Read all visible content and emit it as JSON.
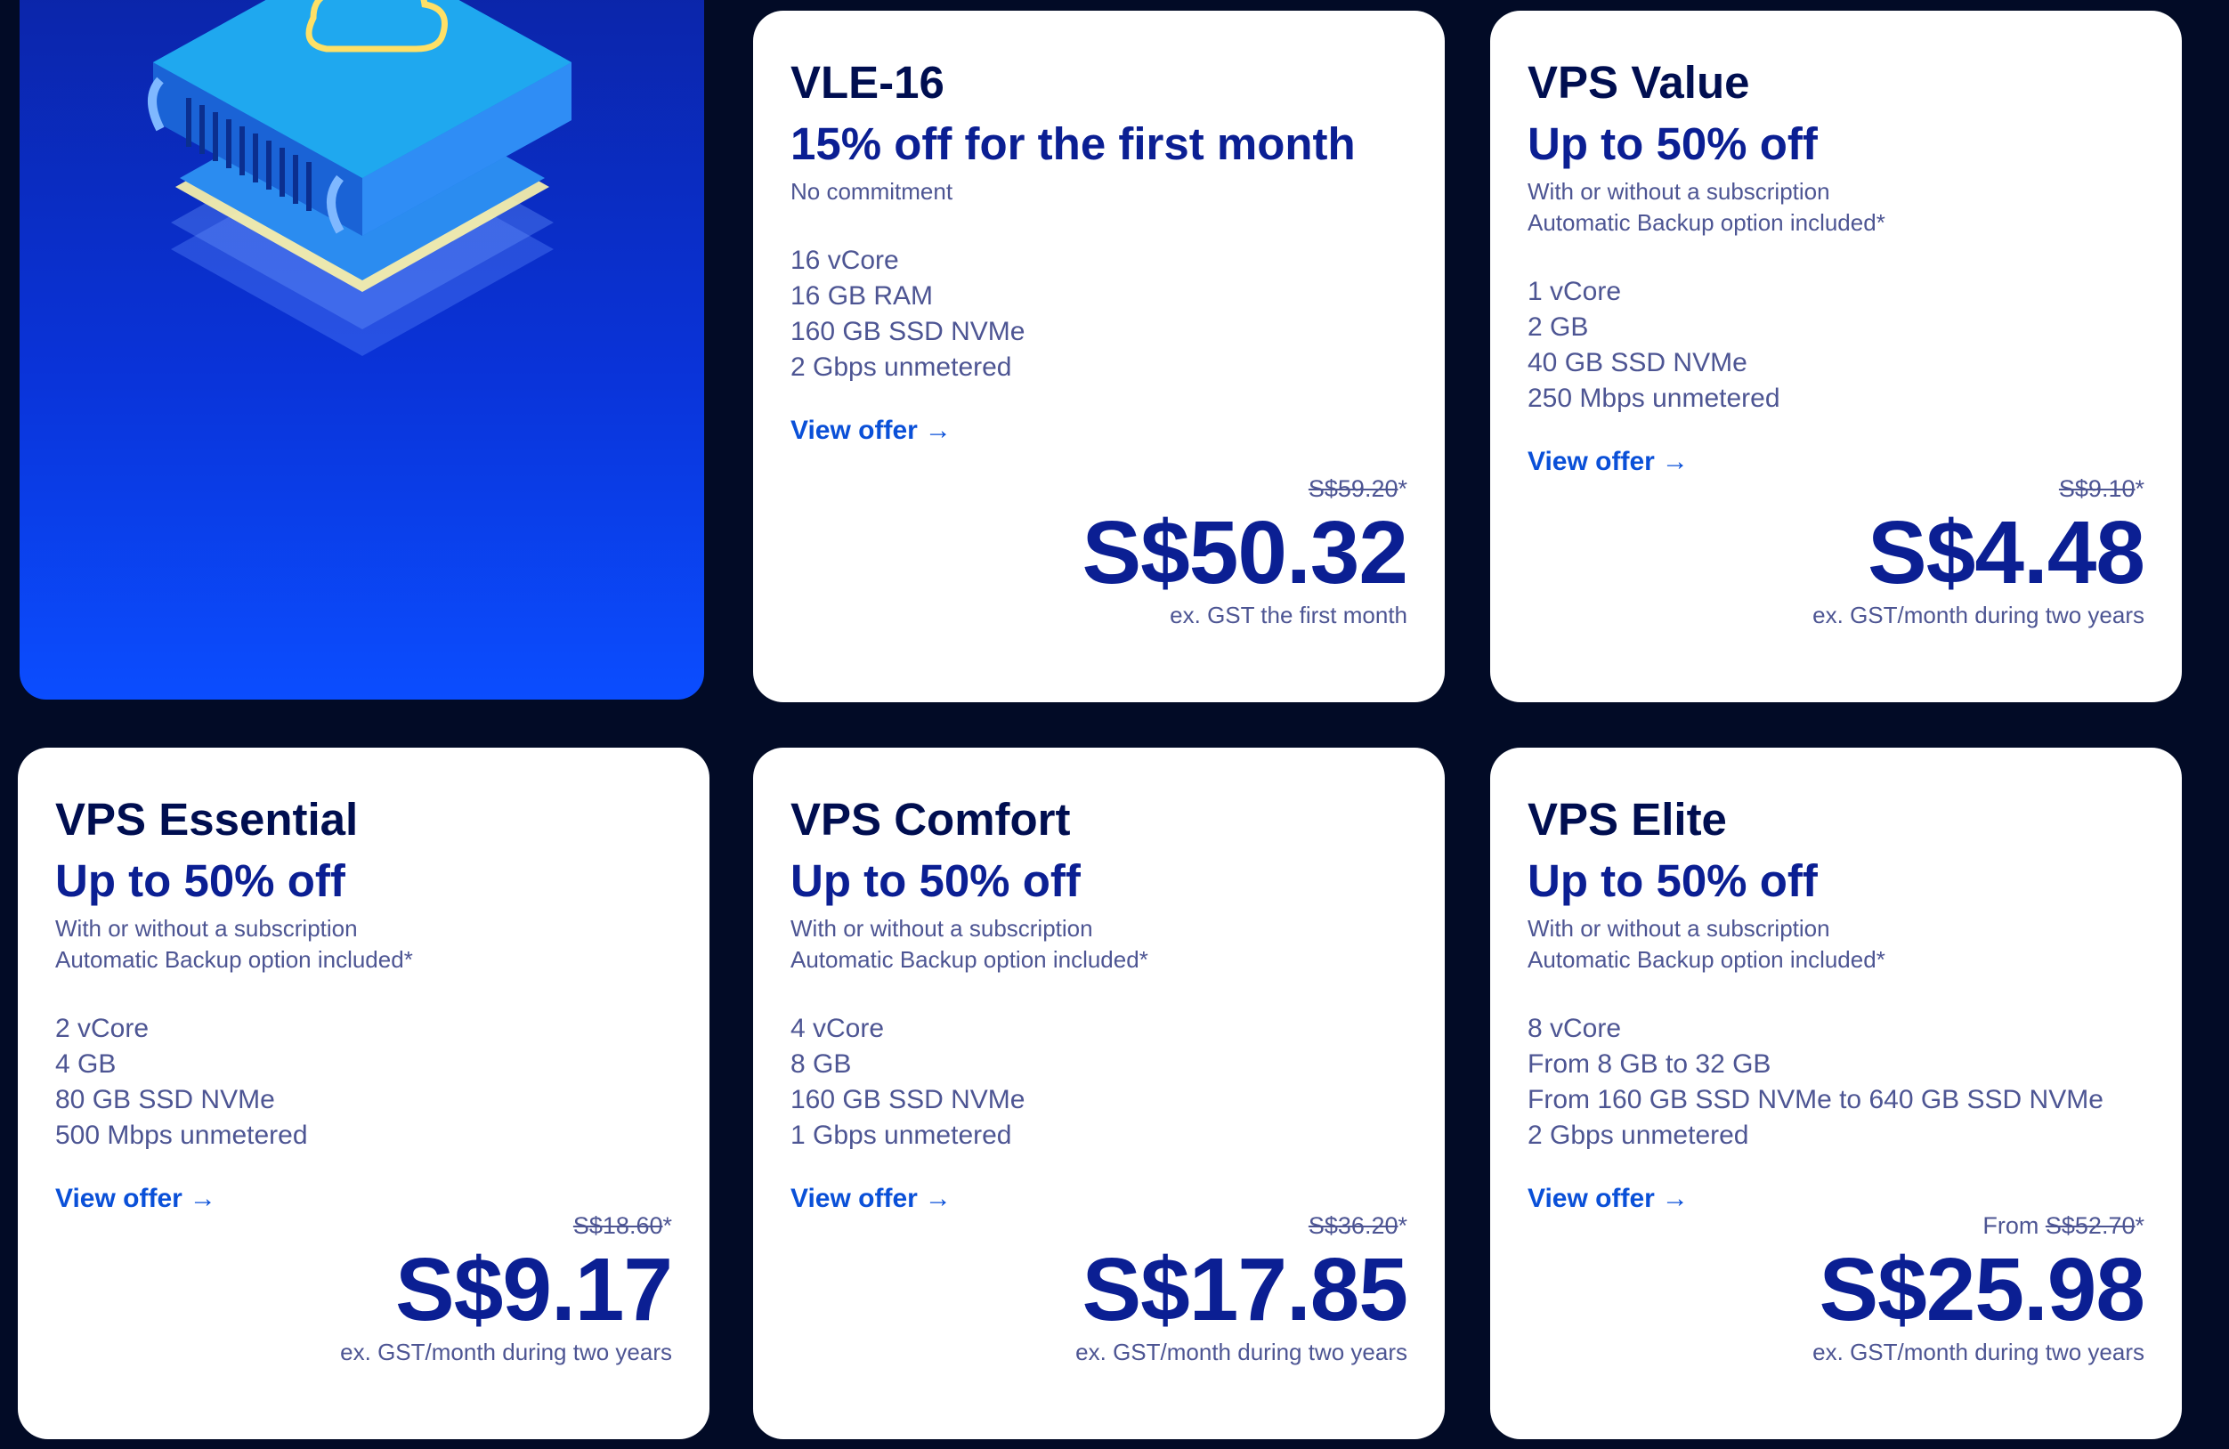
{
  "cards": [
    {
      "name": "VLE-16",
      "promo": "15% off for the first month",
      "subs": [
        "No commitment"
      ],
      "specs": [
        "16 vCore",
        "16 GB RAM",
        "160 GB SSD NVMe",
        "2 Gbps unmetered"
      ],
      "link": "View offer",
      "from": "",
      "old_price": "S$59.20",
      "asterisk": "*",
      "price": "S$50.32",
      "note": "ex. GST the first month"
    },
    {
      "name": "VPS Value",
      "promo": "Up to 50% off",
      "subs": [
        "With or without a subscription",
        "Automatic Backup option included*"
      ],
      "specs": [
        "1 vCore",
        "2 GB",
        "40 GB SSD NVMe",
        "250 Mbps unmetered"
      ],
      "link": "View offer",
      "from": "",
      "old_price": "S$9.10",
      "asterisk": "*",
      "price": "S$4.48",
      "note": "ex. GST/month during two years"
    },
    {
      "name": "VPS Essential",
      "promo": "Up to 50% off",
      "subs": [
        "With or without a subscription",
        "Automatic Backup option included*"
      ],
      "specs": [
        "2 vCore",
        "4 GB",
        "80 GB SSD NVMe",
        "500 Mbps unmetered"
      ],
      "link": "View offer",
      "from": "",
      "old_price": "S$18.60",
      "asterisk": "*",
      "price": "S$9.17",
      "note": "ex. GST/month during two years"
    },
    {
      "name": "VPS Comfort",
      "promo": "Up to 50% off",
      "subs": [
        "With or without a subscription",
        "Automatic Backup option included*"
      ],
      "specs": [
        "4 vCore",
        "8 GB",
        "160 GB SSD NVMe",
        "1 Gbps unmetered"
      ],
      "link": "View offer",
      "from": "",
      "old_price": "S$36.20",
      "asterisk": "*",
      "price": "S$17.85",
      "note": "ex. GST/month during two years"
    },
    {
      "name": "VPS Elite",
      "promo": "Up to 50% off",
      "subs": [
        "With or without a subscription",
        "Automatic Backup option included*"
      ],
      "specs": [
        "8 vCore",
        "From 8 GB to 32 GB",
        "From 160 GB SSD NVMe to 640 GB SSD NVMe",
        "2 Gbps unmetered"
      ],
      "link": "View offer",
      "from": "From",
      "old_price": "S$52.70",
      "asterisk": "*",
      "price": "S$25.98",
      "note": "ex. GST/month during two years"
    }
  ],
  "icons": {
    "hero": "cloud-server-illustration",
    "link_arrow": "arrow-right-icon"
  },
  "colors": {
    "page_bg": "#020b26",
    "card_bg": "#ffffff",
    "title": "#000e50",
    "accent": "#0b1f93",
    "link": "#0a50d8",
    "muted": "#4d5593"
  }
}
